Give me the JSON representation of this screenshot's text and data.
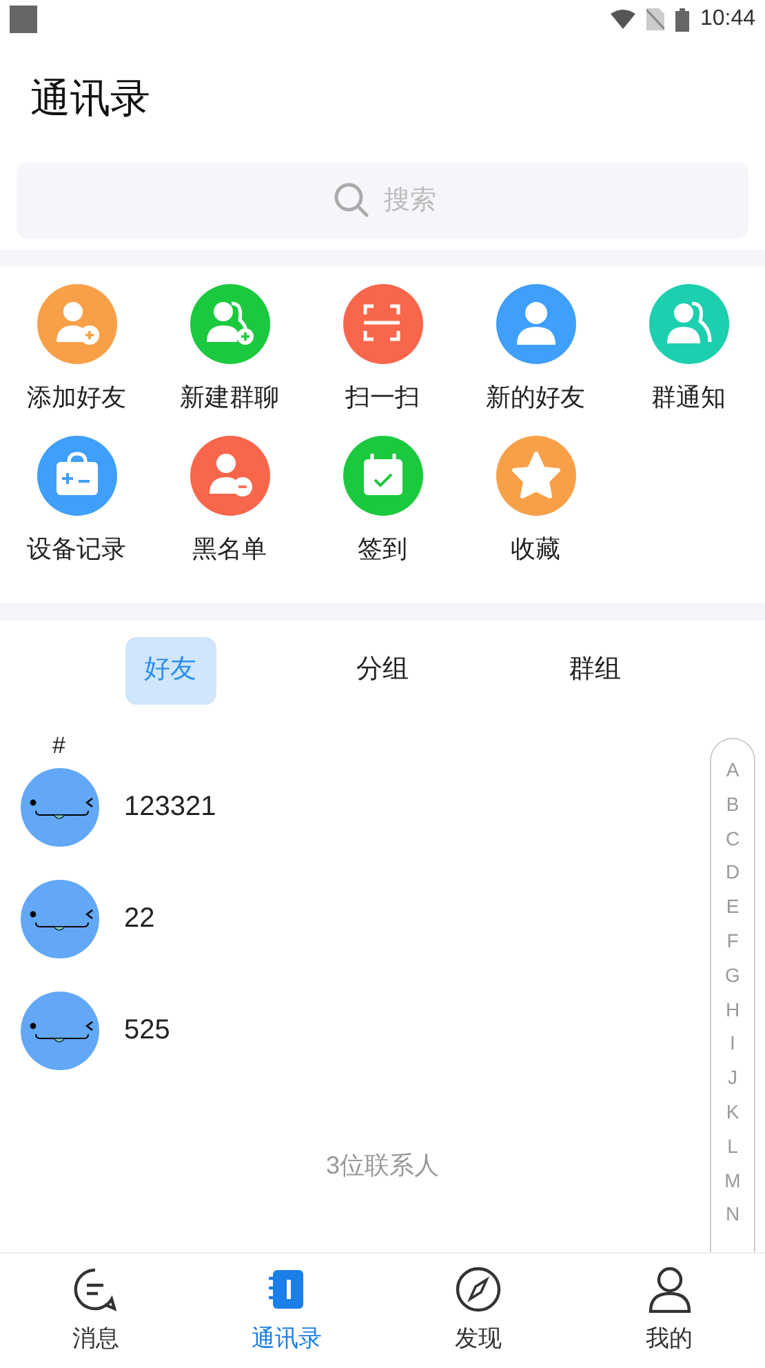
{
  "status_bar": {
    "time": "10:44"
  },
  "title": "通讯录",
  "search": {
    "placeholder": "搜索"
  },
  "shortcuts": [
    {
      "label": "添加好友",
      "color": "#f8a048"
    },
    {
      "label": "新建群聊",
      "color": "#1bc93f"
    },
    {
      "label": "扫一扫",
      "color": "#f8664c"
    },
    {
      "label": "新的好友",
      "color": "#3f9ffa"
    },
    {
      "label": "群通知",
      "color": "#1ccfae"
    },
    {
      "label": "设备记录",
      "color": "#3f9ffa"
    },
    {
      "label": "黑名单",
      "color": "#f8664c"
    },
    {
      "label": "签到",
      "color": "#1bc93f"
    },
    {
      "label": "收藏",
      "color": "#f8a048"
    }
  ],
  "tabs": [
    {
      "label": "好友",
      "selected": true
    },
    {
      "label": "分组",
      "selected": false
    },
    {
      "label": "群组",
      "selected": false
    }
  ],
  "section_header": "#",
  "contacts": [
    {
      "name": "123321"
    },
    {
      "name": "22"
    },
    {
      "name": "525"
    }
  ],
  "contact_count": "3位联系人",
  "index_letters": [
    "A",
    "B",
    "C",
    "D",
    "E",
    "F",
    "G",
    "H",
    "I",
    "J",
    "K",
    "L",
    "M",
    "N"
  ],
  "bottom_nav": [
    {
      "label": "消息",
      "selected": false
    },
    {
      "label": "通讯录",
      "selected": true
    },
    {
      "label": "发现",
      "selected": false
    },
    {
      "label": "我的",
      "selected": false
    }
  ]
}
